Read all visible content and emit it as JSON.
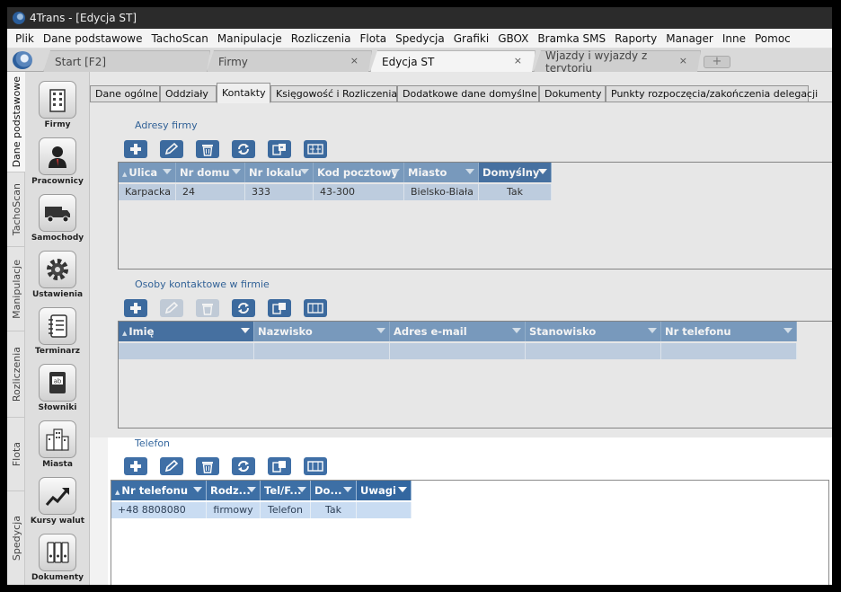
{
  "window": {
    "title": "4Trans - [Edycja ST]"
  },
  "menu": [
    "Plik",
    "Dane podstawowe",
    "TachoScan",
    "Manipulacje",
    "Rozliczenia",
    "Flota",
    "Spedycja",
    "Grafiki",
    "GBOX",
    "Bramka SMS",
    "Raporty",
    "Manager",
    "Inne",
    "Pomoc"
  ],
  "doc_tabs": [
    {
      "label": "Start [F2]",
      "closable": false
    },
    {
      "label": "Firmy",
      "closable": true
    },
    {
      "label": "Edycja ST",
      "closable": true,
      "active": true
    },
    {
      "label": "Wjazdy i wyjazdy z terytoriu",
      "closable": true
    }
  ],
  "new_tab_symbol": "+",
  "close_symbol": "×",
  "side_tabs": [
    "Dane podstawowe",
    "TachoScan",
    "Manipulacje",
    "Rozliczenia",
    "Flota",
    "Spedycja"
  ],
  "side_buttons": [
    {
      "label": "Firmy",
      "icon": "building-icon"
    },
    {
      "label": "Pracownicy",
      "icon": "person-icon"
    },
    {
      "label": "Samochody",
      "icon": "truck-icon"
    },
    {
      "label": "Ustawienia",
      "icon": "gear-icon"
    },
    {
      "label": "Terminarz",
      "icon": "notebook-icon"
    },
    {
      "label": "Słowniki",
      "icon": "dictionary-icon"
    },
    {
      "label": "Miasta",
      "icon": "city-icon"
    },
    {
      "label": "Kursy walut",
      "icon": "chart-up-icon"
    },
    {
      "label": "Dokumenty",
      "icon": "binders-icon"
    }
  ],
  "page_tabs": [
    "Dane ogólne",
    "Oddziały",
    "Kontakty",
    "Księgowość i Rozliczenia",
    "Dodatkowe dane domyślne",
    "Dokumenty",
    "Punkty rozpoczęcia/zakończenia delegacji"
  ],
  "active_page_tab": "Kontakty",
  "toolbar_buttons": [
    "add-icon",
    "edit-icon",
    "delete-icon",
    "refresh-icon",
    "import-icon",
    "columns-icon"
  ],
  "addresses": {
    "title": "Adresy firmy",
    "columns": [
      "Ulica",
      "Nr domu",
      "Nr lokalu",
      "Kod pocztowy",
      "Miasto",
      "Domyślny"
    ],
    "rows": [
      [
        "Karpacka",
        "24",
        "333",
        "43-300",
        "Bielsko-Biała",
        "Tak"
      ]
    ]
  },
  "contacts": {
    "title": "Osoby kontaktowe w firmie",
    "columns": [
      "Imię",
      "Nazwisko",
      "Adres e-mail",
      "Stanowisko",
      "Nr telefonu"
    ],
    "rows": []
  },
  "phones": {
    "title": "Telefon",
    "columns": [
      "Nr telefonu",
      "Rodz...",
      "Tel/F...",
      "Do...",
      "Uwagi"
    ],
    "rows": [
      [
        "+48 8808080",
        "firmowy",
        "Telefon",
        "Tak",
        ""
      ]
    ]
  }
}
